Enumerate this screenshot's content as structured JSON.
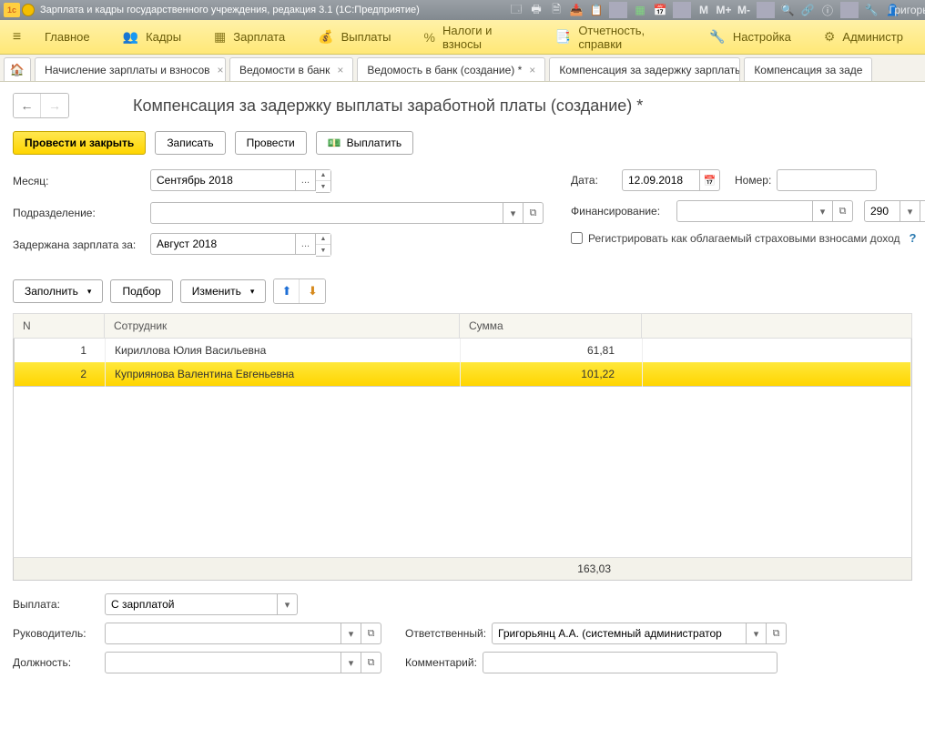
{
  "title_bar": {
    "app_title": "Зарплата и кадры государственного учреждения, редакция 3.1  (1С:Предприятие)",
    "user": "Григорь",
    "m_labels": [
      "M",
      "M+",
      "M-"
    ]
  },
  "main_menu": {
    "items": [
      {
        "icon": "",
        "label": "Главное"
      },
      {
        "icon": "👥",
        "label": "Кадры"
      },
      {
        "icon": "▦",
        "label": "Зарплата"
      },
      {
        "icon": "💰",
        "label": "Выплаты"
      },
      {
        "icon": "%",
        "label": "Налоги и взносы"
      },
      {
        "icon": "📑",
        "label": "Отчетность, справки"
      },
      {
        "icon": "🔧",
        "label": "Настройка"
      },
      {
        "icon": "⚙",
        "label": "Администр"
      }
    ]
  },
  "tabs": [
    {
      "label": "Начисление зарплаты и взносов",
      "closable": true
    },
    {
      "label": "Ведомости в банк",
      "closable": true
    },
    {
      "label": "Ведомость в банк (создание) *",
      "closable": true
    },
    {
      "label": "Компенсация за задержку зарплаты",
      "closable": true
    },
    {
      "label": "Компенсация за заде",
      "closable": false,
      "active": true
    }
  ],
  "page": {
    "title": "Компенсация за задержку выплаты заработной платы (создание) *"
  },
  "commands": {
    "post_close": "Провести и закрыть",
    "save": "Записать",
    "post": "Провести",
    "pay": "Выплатить"
  },
  "fields": {
    "month_label": "Месяц:",
    "month_value": "Сентябрь 2018",
    "dept_label": "Подразделение:",
    "dept_value": "",
    "delayed_label": "Задержана зарплата за:",
    "delayed_value": "Август 2018",
    "date_label": "Дата:",
    "date_value": "12.09.2018",
    "number_label": "Номер:",
    "number_value": "",
    "finance_label": "Финансирование:",
    "finance_value": "",
    "finance_code": "290",
    "register_label": "Регистрировать как облагаемый страховыми взносами доход"
  },
  "grid_toolbar": {
    "fill": "Заполнить",
    "pick": "Подбор",
    "edit": "Изменить"
  },
  "grid": {
    "columns": {
      "n": "N",
      "emp": "Сотрудник",
      "sum": "Сумма"
    },
    "rows": [
      {
        "n": "1",
        "emp": "Кириллова Юлия Васильевна",
        "sum": "61,81",
        "sel": false
      },
      {
        "n": "2",
        "emp": "Куприянова Валентина Евгеньевна",
        "sum": "101,22",
        "sel": true
      }
    ],
    "total": "163,03"
  },
  "bottom": {
    "payout_label": "Выплата:",
    "payout_value": "С зарплатой",
    "manager_label": "Руководитель:",
    "manager_value": "",
    "position_label": "Должность:",
    "position_value": "",
    "responsible_label": "Ответственный:",
    "responsible_value": "Григорьянц А.А. (системный администратор",
    "comment_label": "Комментарий:",
    "comment_value": ""
  }
}
